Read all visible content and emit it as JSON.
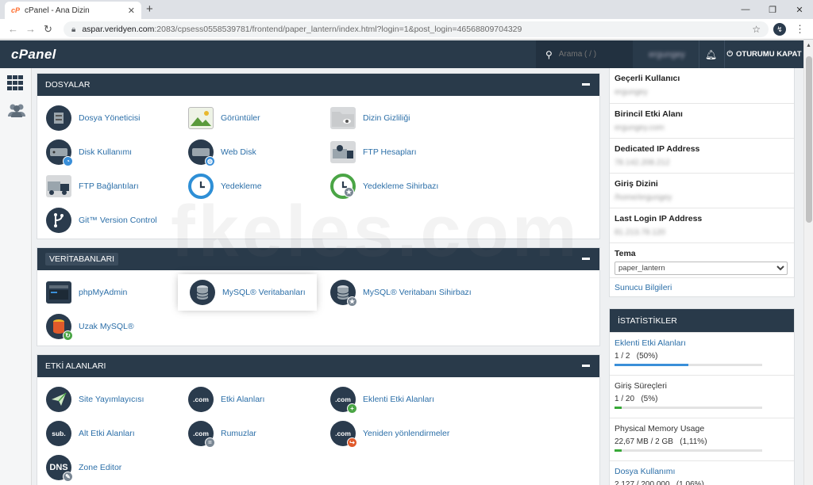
{
  "browser": {
    "tab_favicon": "cP",
    "tab_title": "cPanel - Ana Dizin",
    "url_host": "aspar.veridyen.com",
    "url_rest": ":2083/cpsess0558539781/frontend/paper_lantern/index.html?login=1&post_login=46568809704329",
    "extension_label": "↯"
  },
  "header": {
    "logo": "cPanel",
    "search_placeholder": "Arama ( / )",
    "username": "ergungey",
    "logout_label": "OTURUMU KAPAT"
  },
  "watermark": "fkeles.com",
  "sections": {
    "files": {
      "title": "DOSYALAR",
      "items": [
        {
          "label": "Dosya Yöneticisi"
        },
        {
          "label": "Görüntüler"
        },
        {
          "label": "Dizin Gizliliği"
        },
        {
          "label": "Disk Kullanımı"
        },
        {
          "label": "Web Disk"
        },
        {
          "label": "FTP Hesapları"
        },
        {
          "label": "FTP Bağlantıları"
        },
        {
          "label": "Yedekleme"
        },
        {
          "label": "Yedekleme Sihirbazı"
        },
        {
          "label": "Git™ Version Control"
        }
      ]
    },
    "databases": {
      "title": "VERİTABANLARI",
      "items": [
        {
          "label": "phpMyAdmin"
        },
        {
          "label": "MySQL® Veritabanları"
        },
        {
          "label": "MySQL® Veritabanı Sihirbazı"
        },
        {
          "label": "Uzak MySQL®"
        }
      ]
    },
    "domains": {
      "title": "ETKİ ALANLARI",
      "items": [
        {
          "label": "Site Yayımlayıcısı"
        },
        {
          "label": "Etki Alanları"
        },
        {
          "label": "Eklenti Etki Alanları"
        },
        {
          "label": "Alt Etki Alanları"
        },
        {
          "label": "Rumuzlar"
        },
        {
          "label": "Yeniden yönlendirmeler"
        },
        {
          "label": "Zone Editor"
        }
      ],
      "icon_texts": {
        "com": ".com",
        "sub": "sub.",
        "dns": "DNS"
      }
    }
  },
  "general_info": {
    "rows": [
      {
        "key": "Geçerli Kullanıcı",
        "value": "ergungey"
      },
      {
        "key": "Birincil Etki Alanı",
        "value": "ergungey.com"
      },
      {
        "key": "Dedicated IP Address",
        "value": "78.142.208.212"
      },
      {
        "key": "Giriş Dizini",
        "value": "/home/ergungey"
      },
      {
        "key": "Last Login IP Address",
        "value": "81.213.78.120"
      }
    ],
    "theme_label": "Tema",
    "theme_value": "paper_lantern",
    "server_info_link": "Sunucu Bilgileri"
  },
  "statistics": {
    "title": "İSTATİSTİKLER",
    "items": [
      {
        "label": "Eklenti Etki Alanları",
        "value": "1 / 2   (50%)",
        "fraction": 0.5,
        "color": "#3a8fd9",
        "link": true
      },
      {
        "label": "Giriş Süreçleri",
        "value": "1 / 20   (5%)",
        "fraction": 0.05,
        "color": "#38a938",
        "link": false
      },
      {
        "label": "Physical Memory Usage",
        "value": "22,67 MB / 2 GB   (1,11%)",
        "fraction": 0.011,
        "color": "#38a938",
        "link": false
      },
      {
        "label": "Dosya Kullanımı",
        "value": "2.127 / 200.000   (1,06%)",
        "fraction": 0.0106,
        "color": "#38a938",
        "link": true
      }
    ]
  },
  "colors": {
    "header_bg": "#293a4a",
    "link": "#2c6fa8",
    "accent_orange": "#ff6c2c"
  }
}
